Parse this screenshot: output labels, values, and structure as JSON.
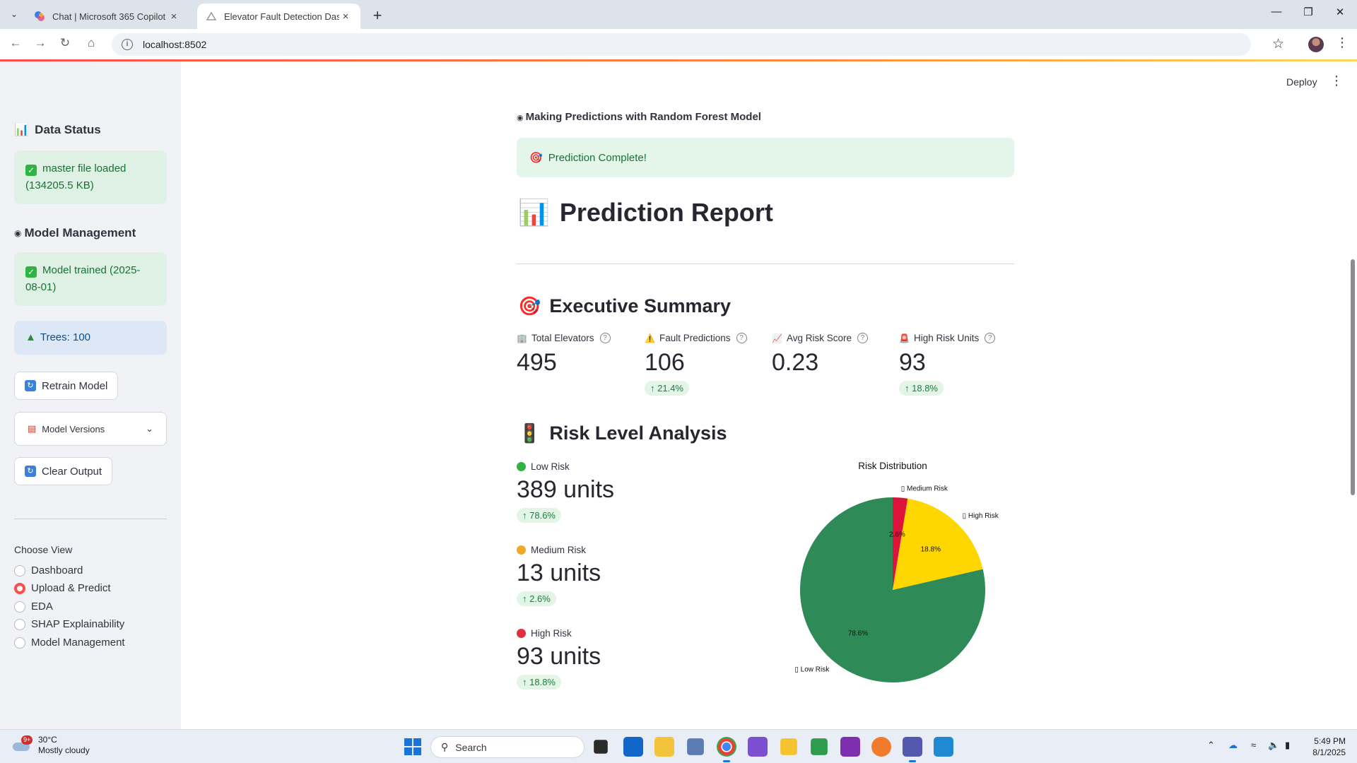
{
  "browser": {
    "tabs": [
      {
        "title": "Chat | Microsoft 365 Copilot",
        "active": false
      },
      {
        "title": "Elevator Fault Detection Dashb",
        "active": true
      }
    ],
    "url": "localhost:8502"
  },
  "sidebar": {
    "data_status_heading": "Data Status",
    "data_status_msg": "master file loaded (134205.5 KB)",
    "model_mgmt_heading": "Model Management",
    "model_trained_msg": "Model trained (2025-08-01)",
    "trees_msg": "Trees: 100",
    "retrain_button": "Retrain Model",
    "model_versions_label": "Model Versions",
    "clear_output_button": "Clear Output",
    "choose_view_label": "Choose View",
    "view_options": [
      "Dashboard",
      "Upload & Predict",
      "EDA",
      "SHAP Explainability",
      "Model Management"
    ],
    "selected_view": "Upload & Predict"
  },
  "header": {
    "deploy_label": "Deploy"
  },
  "main": {
    "caption": "Making Predictions with Random Forest Model",
    "banner": "Prediction Complete!",
    "report_title": "Prediction Report",
    "exec_summary_title": "Executive Summary",
    "metrics": [
      {
        "label": "Total Elevators",
        "value": "495",
        "delta": ""
      },
      {
        "label": "Fault Predictions",
        "value": "106",
        "delta": "21.4%"
      },
      {
        "label": "Avg Risk Score",
        "value": "0.23",
        "delta": ""
      },
      {
        "label": "High Risk Units",
        "value": "93",
        "delta": "18.8%"
      }
    ],
    "risk_title": "Risk Level Analysis",
    "risk_levels": [
      {
        "label": "Low Risk",
        "value": "389 units",
        "delta": "78.6%",
        "color": "#2fb344"
      },
      {
        "label": "Medium Risk",
        "value": "13 units",
        "delta": "2.6%",
        "color": "#f0a92b"
      },
      {
        "label": "High Risk",
        "value": "93 units",
        "delta": "18.8%",
        "color": "#e0303e"
      }
    ]
  },
  "chart_data": {
    "type": "pie",
    "title": "Risk Distribution",
    "categories": [
      "Low Risk",
      "Medium Risk",
      "High Risk"
    ],
    "values": [
      78.6,
      2.6,
      18.8
    ],
    "value_labels": [
      "78.6%",
      "2.6%",
      "18.8%"
    ],
    "category_labels": [
      "▯ Low Risk",
      "▯ Medium Risk",
      "▯ High Risk"
    ],
    "colors": [
      "#2e8b57",
      "#dc143c",
      "#ffd700"
    ],
    "slice_order": [
      "Medium Risk",
      "High Risk",
      "Low Risk"
    ]
  },
  "taskbar": {
    "weather_temp": "30°C",
    "weather_desc": "Mostly cloudy",
    "weather_badge": "9+",
    "search_placeholder": "Search",
    "time": "5:49 PM",
    "date": "8/1/2025"
  }
}
